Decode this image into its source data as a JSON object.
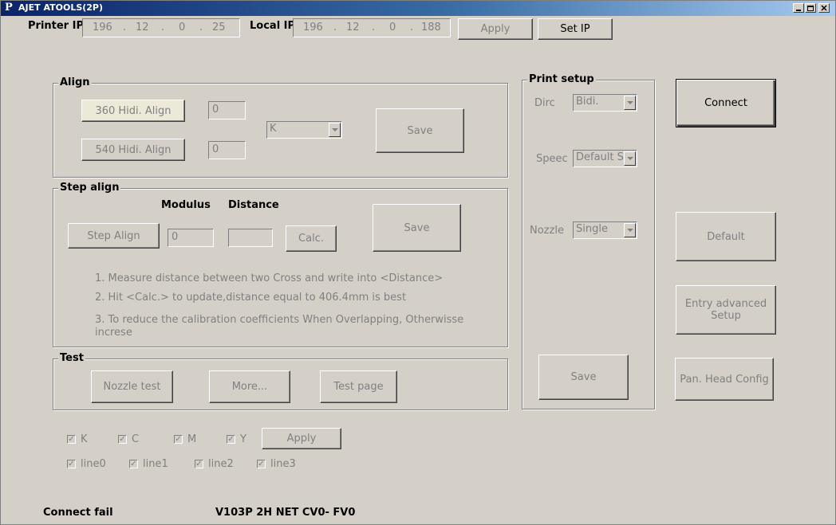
{
  "window": {
    "app_icon": "P",
    "title": "AJET ATOOLS(2P)"
  },
  "header": {
    "printer_ip_label": "Printer IP",
    "printer_ip": [
      "196",
      "12",
      "0",
      "25"
    ],
    "local_ip_label": "Local IP",
    "local_ip": [
      "196",
      "12",
      "0",
      "188"
    ],
    "apply_label": "Apply",
    "set_ip_label": "Set IP"
  },
  "align": {
    "title": "Align",
    "btn_360": "360 Hidi. Align",
    "value_360": "0",
    "btn_540": "540 Hidi. Align",
    "value_540": "0",
    "color_select": "K",
    "save_label": "Save"
  },
  "step_align": {
    "title": "Step align",
    "modulus_label": "Modulus",
    "distance_label": "Distance",
    "step_align_btn": "Step Align",
    "modulus_value": "0",
    "distance_value": "",
    "calc_label": "Calc.",
    "save_label": "Save",
    "instructions": [
      "1. Measure distance between two Cross and write into <Distance>",
      "2. Hit <Calc.> to update,distance equal to 406.4mm is best",
      "3. To reduce the calibration coefficients When Overlapping, Otherwisse",
      "increse"
    ]
  },
  "test": {
    "title": "Test",
    "nozzle_test": "Nozzle test",
    "more": "More...",
    "test_page": "Test page"
  },
  "colors": {
    "checks": [
      "K",
      "C",
      "M",
      "Y"
    ],
    "apply_label": "Apply",
    "lines": [
      "line0",
      "line1",
      "line2",
      "line3"
    ]
  },
  "print_setup": {
    "title": "Print setup",
    "dirc_label": "Dirc",
    "dirc_value": "Bidi.",
    "speed_label": "Speec",
    "speed_value": "Default S",
    "nozzle_label": "Nozzle",
    "nozzle_value": "Single",
    "save_label": "Save"
  },
  "right_panel": {
    "connect": "Connect",
    "default": "Default",
    "advanced_line1": "Entry advanced",
    "advanced_line2": "Setup",
    "head_config": "Pan. Head Config"
  },
  "status": {
    "connection": "Connect fail",
    "version": "V103P 2H NET  CV0- FV0"
  }
}
